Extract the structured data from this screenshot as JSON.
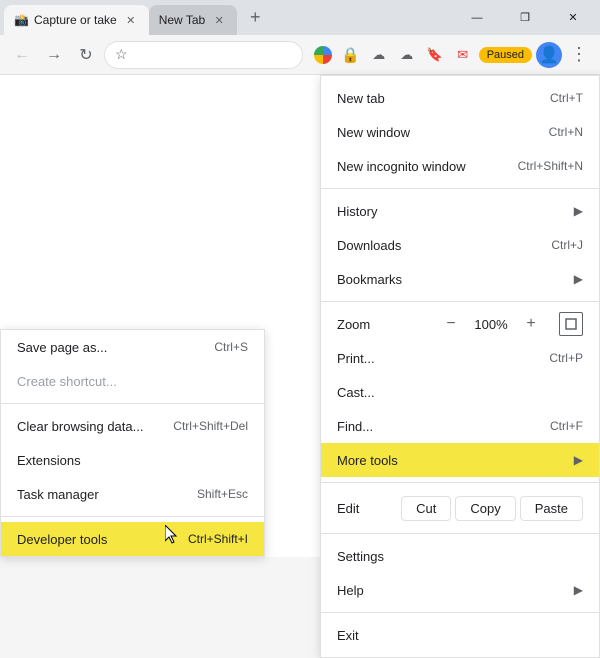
{
  "browser": {
    "tabs": [
      {
        "id": "tab1",
        "title": "Capture or take",
        "favicon": "📸",
        "active": true
      },
      {
        "id": "tab2",
        "title": "New Tab",
        "favicon": "",
        "active": false
      }
    ],
    "new_tab_label": "+",
    "window_controls": [
      "—",
      "❐",
      "✕"
    ],
    "toolbar": {
      "back": "←",
      "forward": "→",
      "reload": "↻",
      "address": "",
      "star": "☆",
      "extensions": [
        "G",
        "🔒",
        "☁",
        "📎",
        "🔖",
        "✉"
      ],
      "paused": "Paused",
      "menu_dots": "⋮"
    }
  },
  "right_menu": {
    "items": [
      {
        "id": "new-tab",
        "label": "New tab",
        "shortcut": "Ctrl+T",
        "disabled": false
      },
      {
        "id": "new-window",
        "label": "New window",
        "shortcut": "Ctrl+N",
        "disabled": false
      },
      {
        "id": "new-incognito",
        "label": "New incognito window",
        "shortcut": "Ctrl+Shift+N",
        "disabled": false
      },
      {
        "id": "divider1",
        "type": "divider"
      },
      {
        "id": "history",
        "label": "History",
        "arrow": "▶",
        "disabled": false
      },
      {
        "id": "downloads",
        "label": "Downloads",
        "shortcut": "Ctrl+J",
        "disabled": false
      },
      {
        "id": "bookmarks",
        "label": "Bookmarks",
        "arrow": "▶",
        "disabled": false
      },
      {
        "id": "divider2",
        "type": "divider"
      },
      {
        "id": "zoom",
        "label": "Zoom",
        "minus": "−",
        "value": "100%",
        "plus": "+",
        "expand": "⤢",
        "type": "zoom"
      },
      {
        "id": "print",
        "label": "Print...",
        "shortcut": "Ctrl+P",
        "disabled": false
      },
      {
        "id": "cast",
        "label": "Cast...",
        "disabled": false
      },
      {
        "id": "find",
        "label": "Find...",
        "shortcut": "Ctrl+F",
        "disabled": false
      },
      {
        "id": "more-tools",
        "label": "More tools",
        "arrow": "▶",
        "highlighted": true,
        "disabled": false
      },
      {
        "id": "divider3",
        "type": "divider"
      },
      {
        "id": "edit",
        "label": "Edit",
        "type": "edit",
        "buttons": [
          "Cut",
          "Copy",
          "Paste"
        ]
      },
      {
        "id": "divider4",
        "type": "divider"
      },
      {
        "id": "settings",
        "label": "Settings",
        "disabled": false
      },
      {
        "id": "help",
        "label": "Help",
        "arrow": "▶",
        "disabled": false
      },
      {
        "id": "divider5",
        "type": "divider"
      },
      {
        "id": "exit",
        "label": "Exit",
        "disabled": false
      }
    ]
  },
  "left_menu": {
    "items": [
      {
        "id": "save-page",
        "label": "Save page as...",
        "shortcut": "Ctrl+S",
        "disabled": false
      },
      {
        "id": "create-shortcut",
        "label": "Create shortcut...",
        "disabled": true
      },
      {
        "id": "divider1",
        "type": "divider"
      },
      {
        "id": "clear-data",
        "label": "Clear browsing data...",
        "shortcut": "Ctrl+Shift+Del",
        "disabled": false
      },
      {
        "id": "extensions",
        "label": "Extensions",
        "disabled": false
      },
      {
        "id": "task-manager",
        "label": "Task manager",
        "shortcut": "Shift+Esc",
        "disabled": false
      },
      {
        "id": "divider2",
        "type": "divider"
      },
      {
        "id": "developer-tools",
        "label": "Developer tools",
        "shortcut": "Ctrl+Shift+I",
        "highlighted": true,
        "disabled": false
      }
    ]
  },
  "zoom": {
    "minus": "−",
    "value": "100%",
    "plus": "+"
  },
  "edit_buttons": {
    "cut": "Cut",
    "copy": "Copy",
    "paste": "Paste"
  }
}
